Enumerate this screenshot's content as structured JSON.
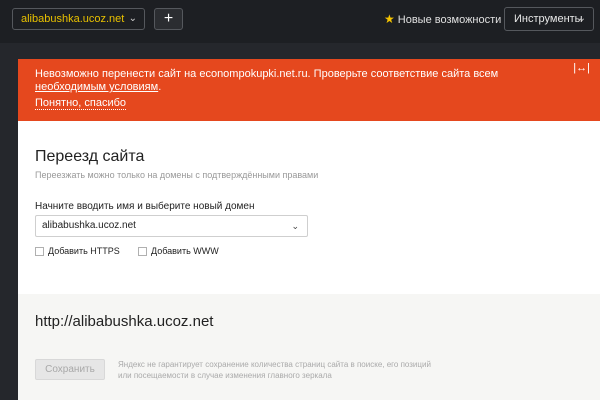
{
  "topbar": {
    "site": "alibabushka.ucoz.net",
    "add_label": "+",
    "features_label": "Новые возможности",
    "tools_label": "Инструменты"
  },
  "alert": {
    "text_before_link": "Невозможно перенести сайт на econompokupki.net.ru. Проверьте соответствие сайта всем ",
    "link": "необходимым условиям",
    "text_after_link": ".",
    "dismiss": "Понятно, спасибо",
    "expand_icon": "|↔|"
  },
  "main": {
    "title": "Переезд сайта",
    "subtitle": "Переезжать можно только на домены с подтверждёнными правами",
    "field_label": "Начните вводить имя и выберите новый домен",
    "domain_value": "alibabushka.ucoz.net",
    "checkbox_https": "Добавить HTTPS",
    "checkbox_www": "Добавить WWW"
  },
  "bottom": {
    "url": "http://alibabushka.ucoz.net",
    "save_label": "Сохранить",
    "disclaimer": "Яндекс не гарантирует сохранение количества страниц сайта в поиске, его позиций или посещаемости в случае изменения главного зеркала"
  },
  "colors": {
    "alert_bg": "#e5481e",
    "topbar_bg": "#1d1f23",
    "site_text": "#e8c000"
  },
  "icons": {
    "chevron": "chevron-down-icon",
    "star": "star-icon",
    "expand": "expand-icon"
  }
}
